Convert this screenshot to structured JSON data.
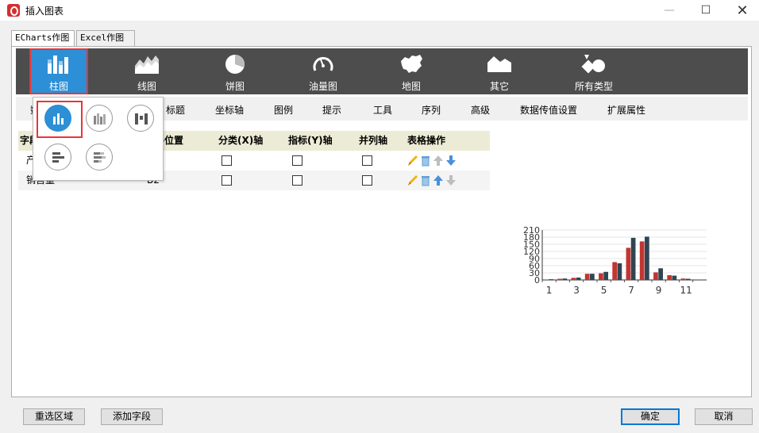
{
  "window": {
    "title": "插入图表",
    "min": "—",
    "max": "☐",
    "close": "✕"
  },
  "tabs": [
    {
      "label": "ECharts作图"
    },
    {
      "label": "Excel作图"
    }
  ],
  "chart_types": [
    {
      "label": "柱图",
      "icon": "bar-chart-icon"
    },
    {
      "label": "线图",
      "icon": "line-chart-icon"
    },
    {
      "label": "饼图",
      "icon": "pie-chart-icon"
    },
    {
      "label": "油量图",
      "icon": "gauge-icon"
    },
    {
      "label": "地图",
      "icon": "map-icon"
    },
    {
      "label": "其它",
      "icon": "other-chart-icon"
    },
    {
      "label": "所有类型",
      "icon": "all-types-icon"
    }
  ],
  "subtabs": [
    "标题",
    "坐标轴",
    "图例",
    "提示",
    "工具",
    "序列",
    "高级",
    "数据传值设置",
    "扩展属性"
  ],
  "subtab_partial": "数",
  "table": {
    "headers": {
      "col1_partial": "字段",
      "col2_partial": "格位置",
      "category": "分类(X)轴",
      "metric": "指标(Y)轴",
      "parallel": "并列轴",
      "ops": "表格操作"
    },
    "rows": [
      {
        "field_partial": "产",
        "pos": ""
      },
      {
        "field_partial": "销售量",
        "pos": "B2"
      }
    ]
  },
  "popup": {
    "items": [
      "basic-bar-icon",
      "stacked-bar-icon",
      "waterfall-bar-icon",
      "horizontal-bar-icon",
      "horizontal-stacked-bar-icon"
    ]
  },
  "buttons": {
    "reselect": "重选区域",
    "add_field": "添加字段",
    "ok": "确定",
    "cancel": "取消"
  },
  "colors": {
    "accent": "#2d8fd5",
    "highlight": "#e33333",
    "series_a": "#c23531",
    "series_b": "#2f4554"
  },
  "chart_data": {
    "type": "bar",
    "categories": [
      1,
      2,
      3,
      4,
      5,
      6,
      7,
      8,
      9,
      10,
      11,
      12
    ],
    "series": [
      {
        "values": [
          2,
          5,
          9,
          26,
          28,
          75,
          135,
          162,
          32,
          20,
          6,
          2
        ]
      },
      {
        "values": [
          3,
          6,
          10,
          26,
          34,
          70,
          177,
          182,
          49,
          18,
          5,
          1
        ]
      }
    ],
    "x_tick_labels": [
      "1",
      "3",
      "5",
      "7",
      "9",
      "11"
    ],
    "y_ticks": [
      0,
      30,
      60,
      90,
      120,
      150,
      180,
      210
    ],
    "ylim": [
      0,
      210
    ]
  }
}
